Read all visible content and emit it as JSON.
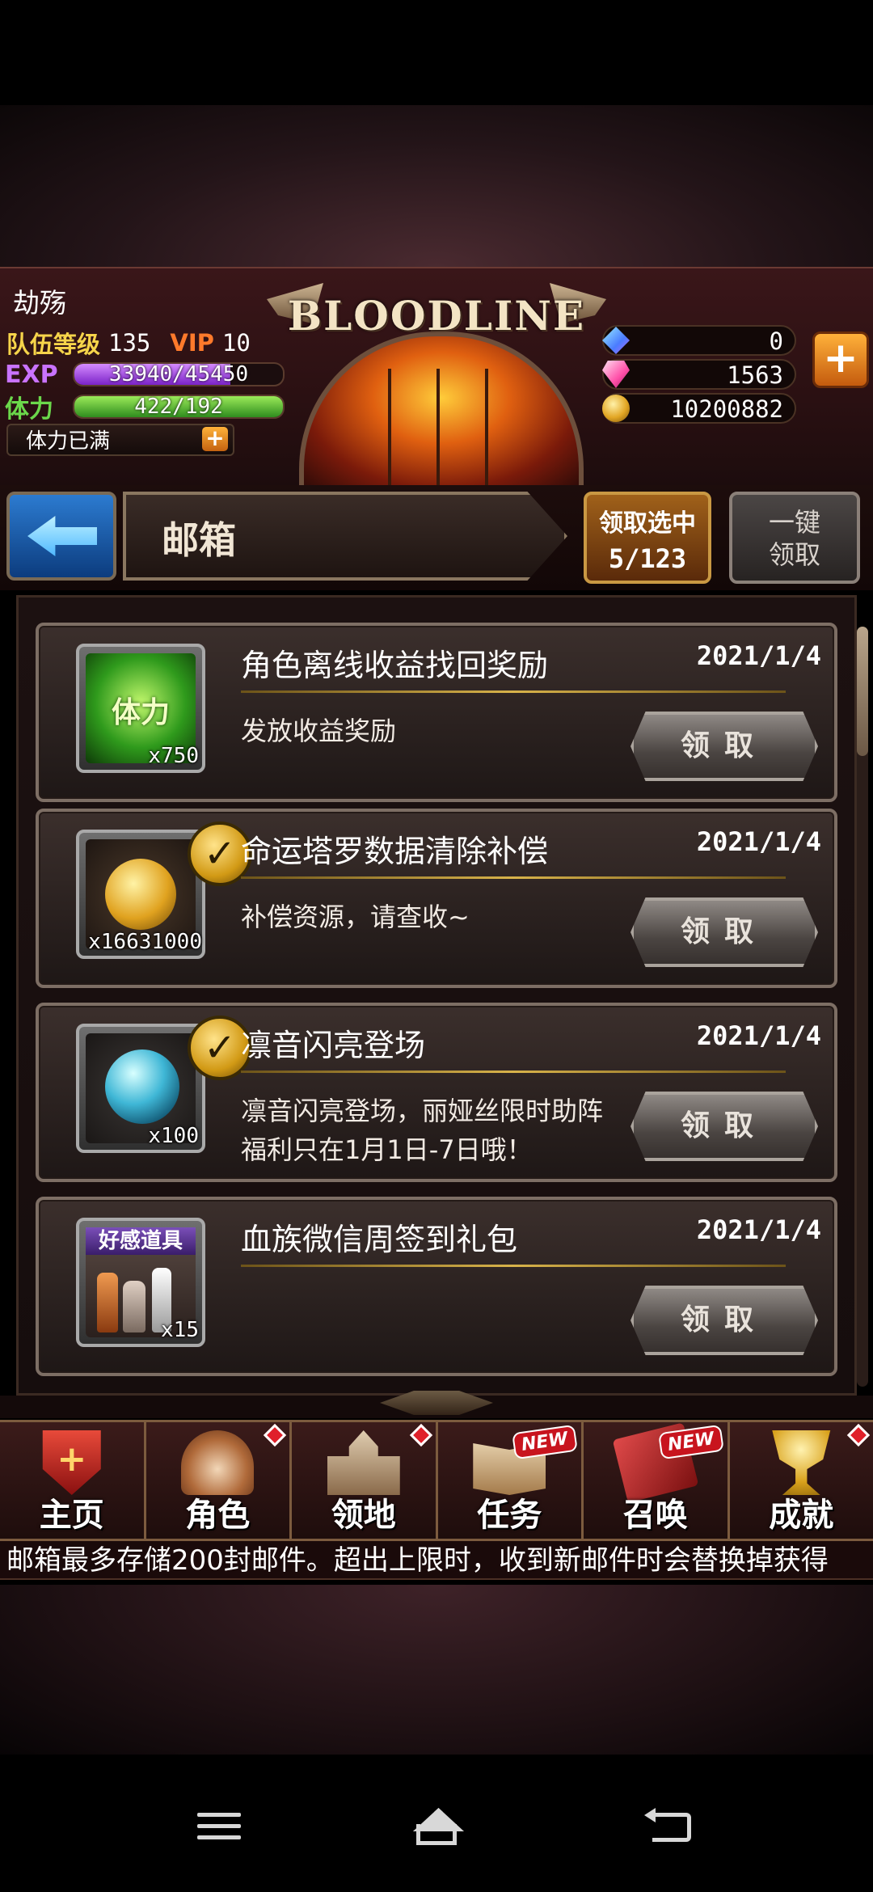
{
  "header": {
    "player_name": "劫殇",
    "team_level_label": "队伍等级",
    "team_level": "135",
    "vip_label": "VIP",
    "vip_level": "10",
    "exp_label": "EXP",
    "exp_text": "33940/45450",
    "exp_fraction": 0.747,
    "stamina_label": "体力",
    "stamina_text": "422/192",
    "stamina_fraction": 1.0,
    "stamina_full_text": "体力已满",
    "logo": "BLOODLINE",
    "currencies": [
      {
        "icon": "crystal-icon",
        "value": "0"
      },
      {
        "icon": "gem-icon",
        "value": "1563"
      },
      {
        "icon": "gold-coin-icon",
        "value": "10200882"
      }
    ]
  },
  "titlebar": {
    "title": "邮箱",
    "claim_selected_label": "领取选中",
    "claim_selected_count": "5/123",
    "claim_all_line1": "一键",
    "claim_all_line2": "领取"
  },
  "mails": [
    {
      "title": "角色离线收益找回奖励",
      "date": "2021/1/4",
      "desc": "发放收益奖励",
      "icon": "stamina-icon",
      "icon_text": "体力",
      "qty": "x750",
      "checked": false,
      "claim": "领取"
    },
    {
      "title": "命运塔罗数据清除补偿",
      "date": "2021/1/4",
      "desc": "补偿资源，请查收~",
      "icon": "gold-coin-icon",
      "qty": "x16631000",
      "checked": true,
      "claim": "领取"
    },
    {
      "title": "凛音闪亮登场",
      "date": "2021/1/4",
      "desc": "凛音闪亮登场，丽娅丝限时助阵福利只在1月1日-7日哦！",
      "icon": "orb-icon",
      "qty": "x100",
      "checked": true,
      "claim": "领取"
    },
    {
      "title": "血族微信周签到礼包",
      "date": "2021/1/4",
      "desc": "",
      "icon": "potion-bottles-icon",
      "icon_text": "好感道具",
      "qty": "x15",
      "checked": false,
      "claim": "领取"
    }
  ],
  "nav": [
    {
      "label": "主页",
      "icon": "home-shield-icon",
      "badge": ""
    },
    {
      "label": "角色",
      "icon": "character-hood-icon",
      "badge": "dot"
    },
    {
      "label": "领地",
      "icon": "castle-icon",
      "badge": "dot"
    },
    {
      "label": "任务",
      "icon": "quest-book-icon",
      "badge": "NEW"
    },
    {
      "label": "召唤",
      "icon": "summon-card-icon",
      "badge": "NEW"
    },
    {
      "label": "成就",
      "icon": "trophy-icon",
      "badge": "dot"
    }
  ],
  "ticker": "邮箱最多存储200封邮件。超出上限时，收到新邮件时会替换掉获得",
  "system_nav": [
    "menu-icon",
    "home-icon",
    "back-icon"
  ]
}
